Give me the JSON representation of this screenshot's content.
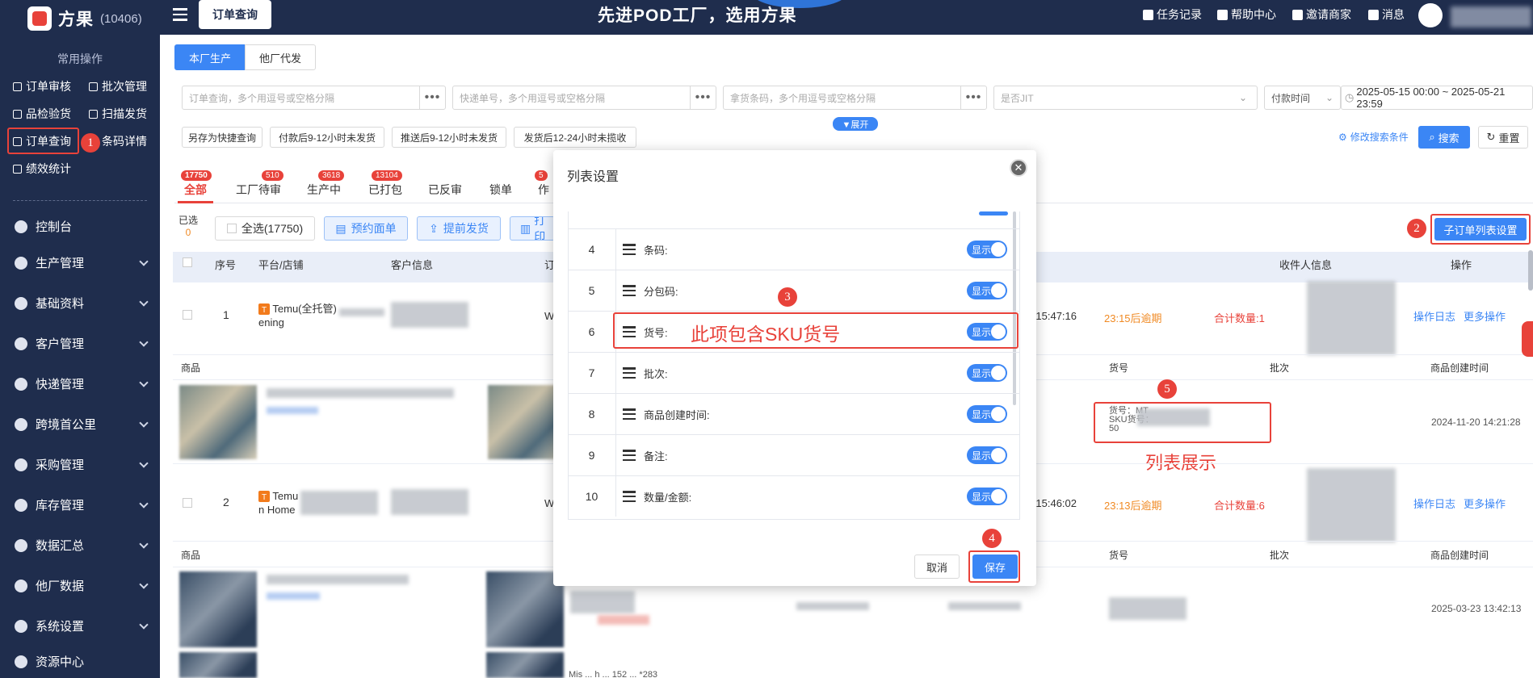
{
  "brand": {
    "name": "方果",
    "code": "(10406)"
  },
  "header": {
    "tab": "订单查询",
    "slogan": "先进POD工厂，选用方果",
    "links": [
      "任务记录",
      "帮助中心",
      "邀请商家",
      "消息"
    ]
  },
  "sidebar": {
    "common_title": "常用操作",
    "quick_ops": [
      "订单审核",
      "批次管理",
      "品检验货",
      "扫描发货",
      "订单查询",
      "条码详情",
      "绩效统计"
    ],
    "nav": [
      "控制台",
      "生产管理",
      "基础资料",
      "客户管理",
      "快递管理",
      "跨境首公里",
      "采购管理",
      "库存管理",
      "数据汇总",
      "他厂数据",
      "系统设置",
      "资源中心"
    ]
  },
  "filters": {
    "seg": [
      "本厂生产",
      "他厂代发"
    ],
    "order_placeholder": "订单查询，多个用逗号或空格分隔",
    "express_placeholder": "快递单号，多个用逗号或空格分隔",
    "barcode_placeholder": "拿货条码，多个用逗号或空格分隔",
    "jit_placeholder": "是否JIT",
    "time_type": "付款时间",
    "date_range": "2025-05-15 00:00 ~ 2025-05-21 23:59",
    "quick": [
      "另存为快捷查询",
      "付款后9-12小时未发货",
      "推送后9-12小时未发货",
      "发货后12-24小时未揽收"
    ],
    "expand": "▼展开",
    "modify": "修改搜索条件",
    "search": "搜索",
    "reset": "重置"
  },
  "tabs": [
    {
      "label": "全部",
      "count": "17750"
    },
    {
      "label": "工厂待审",
      "count": "510"
    },
    {
      "label": "生产中",
      "count": "3618"
    },
    {
      "label": "已打包",
      "count": "13104"
    },
    {
      "label": "已反审",
      "count": ""
    },
    {
      "label": "锁单",
      "count": ""
    },
    {
      "label": "作",
      "count": "5"
    }
  ],
  "toolbar": {
    "selected_label": "已选",
    "selected_count": "0",
    "select_all": "全选(17750)",
    "reserve": "预约面单",
    "advance": "提前发货",
    "print": "打印",
    "sub_settings": "子订单列表设置"
  },
  "table": {
    "headers": [
      "序号",
      "平台/店铺",
      "客户信息",
      "订",
      "收件人信息",
      "操作"
    ],
    "sub_headers": [
      "商品",
      "货号",
      "批次",
      "商品创建时间"
    ],
    "rows": [
      {
        "index": "1",
        "platform": "Temu(全托管)",
        "shop": "ening",
        "col_w": "W",
        "time": "-22 15:47:16",
        "due": "23:15后逾期",
        "total": "合计数量:1",
        "op_log": "操作日志",
        "more": "更多操作",
        "created": "2024-11-20 14:21:28"
      },
      {
        "index": "2",
        "platform": "Temu",
        "shop": "n Home",
        "col_w": "W",
        "time": "-22 15:46:02",
        "due": "23:13后逾期",
        "total": "合计数量:6",
        "op_log": "操作日志",
        "more": "更多操作",
        "created": "2025-03-23 13:42:13"
      }
    ],
    "item_lines": [
      "货号：MT",
      "SKU货号：",
      "50"
    ],
    "footer_text": "Mis ... h ... 152 ... *283"
  },
  "modal": {
    "title": "列表设置",
    "rows": [
      {
        "num": "4",
        "label": "条码:"
      },
      {
        "num": "5",
        "label": "分包码:"
      },
      {
        "num": "6",
        "label": "货号:"
      },
      {
        "num": "7",
        "label": "批次:"
      },
      {
        "num": "8",
        "label": "商品创建时间:"
      },
      {
        "num": "9",
        "label": "备注:"
      },
      {
        "num": "10",
        "label": "数量/金额:"
      }
    ],
    "toggle": "显示",
    "cancel": "取消",
    "save": "保存"
  },
  "annotations": {
    "steps": [
      "1",
      "2",
      "3",
      "4",
      "5"
    ],
    "note_sku": "此项包含SKU货号",
    "note_list": "列表展示"
  },
  "colors": {
    "sidebar": "#1f2d4d",
    "accent": "#3b86f5",
    "annotation": "#e8423a",
    "warning": "#f08a24"
  }
}
